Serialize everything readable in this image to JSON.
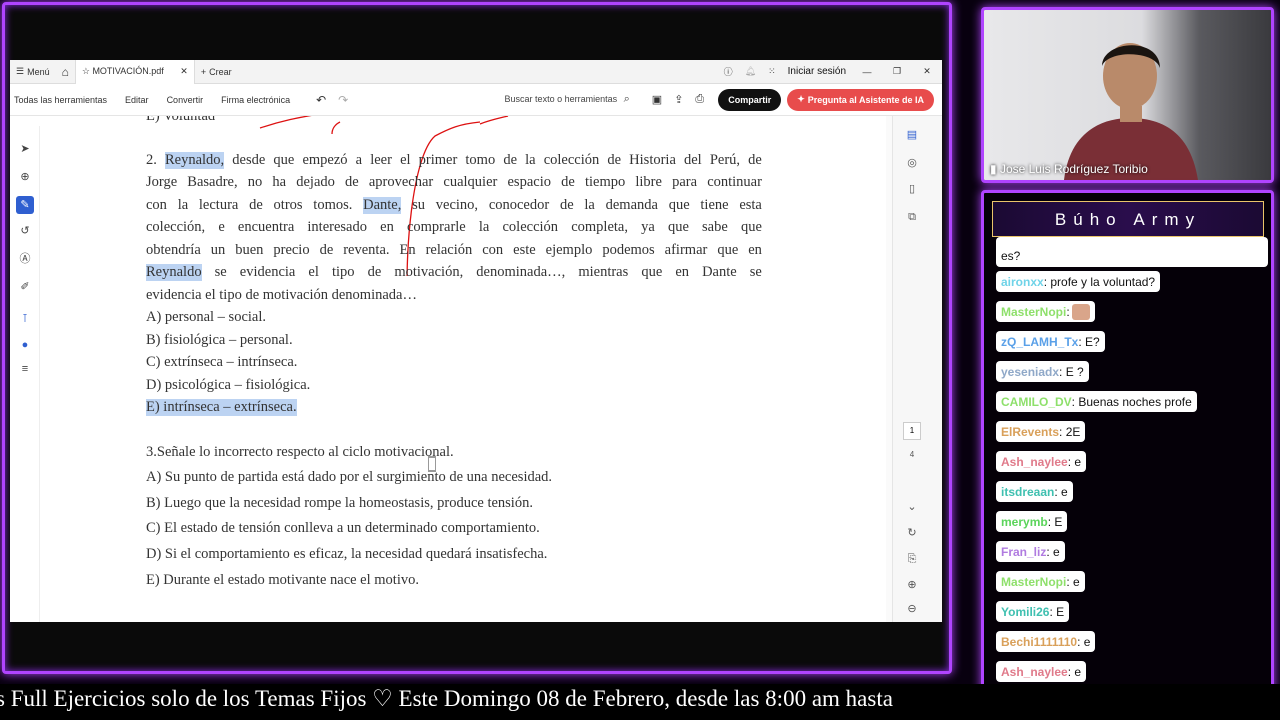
{
  "viewer": {
    "menu_label": "Menú",
    "tab_title": "MOTIVACIÓN.pdf",
    "new_tab_label": "Crear",
    "sign_in": "Iniciar sesión",
    "tools": [
      "Todas las herramientas",
      "Editar",
      "Convertir",
      "Firma electrónica"
    ],
    "search_placeholder": "Buscar texto o herramientas",
    "share_label": "Compartir",
    "ai_label": "Pregunta al Asistente de IA",
    "page_current": "1",
    "page_total": "4"
  },
  "document": {
    "prev_line": "E) Voluntad",
    "q2": {
      "line1": [
        "2.",
        "Reynaldo,",
        "desde",
        "que",
        "empezó",
        "a",
        "leer",
        "el",
        "primer",
        "tomo",
        "de",
        "la",
        "colección",
        "de",
        "Historia",
        "del",
        "Perú,",
        "de"
      ],
      "line2": [
        "Jorge",
        "Basadre,",
        "no",
        "ha",
        "dejado",
        "de",
        "aprovechar",
        "cualquier",
        "espacio",
        "de",
        "tiempo",
        "libre",
        "para",
        "continuar"
      ],
      "line3": [
        "con",
        "la",
        "lectura",
        "de",
        "otros",
        "tomos.",
        "Dante,",
        "su",
        "vecino,",
        "conocedor",
        "de",
        "la",
        "demanda",
        "que",
        "tiene",
        "esta"
      ],
      "line4": [
        "colección,",
        "e",
        "encuentra",
        "interesado",
        "en",
        "comprarle",
        "la",
        "colección",
        "completa,",
        "ya",
        "que",
        "sabe",
        "que"
      ],
      "line5": [
        "obtendría",
        "un",
        "buen",
        "precio",
        "de",
        "reventa.",
        "En",
        "relación",
        "con",
        "este",
        "ejemplo",
        "podemos",
        "afirmar",
        "que",
        "en"
      ],
      "line6": [
        "Reynaldo",
        "se",
        "evidencia",
        "el",
        "tipo",
        "de",
        "motivación,",
        "denominada…,",
        "mientras",
        "que",
        "en",
        "Dante",
        "se"
      ],
      "line7": "evidencia el tipo de motivación denominada…",
      "options": [
        "A) personal – social.",
        "B) fisiológica – personal.",
        "C) extrínseca – intrínseca.",
        "D) psicológica – fisiológica.",
        "E) intrínseca – extrínseca."
      ]
    },
    "q3": {
      "stem": "3.Señale lo incorrecto respecto al ciclo motivacional.",
      "options": [
        "A) Su punto de partida está dado por el surgimiento de una necesidad.",
        "B) Luego que la necesidad rompe la homeostasis, produce tensión.",
        "C) El estado de tensión conlleva a un determinado comportamiento.",
        "D) Si el comportamiento es eficaz, la necesidad quedará insatisfecha.",
        "E) Durante el estado motivante nace el motivo."
      ]
    }
  },
  "webcam": {
    "name": "Jose Luis Rodríguez Toribio"
  },
  "chat": {
    "title": "Búho Army",
    "messages": [
      {
        "user": "",
        "text": "es?",
        "color": "#ffffff"
      },
      {
        "user": "aironxx",
        "text": " : profe y la voluntad?",
        "color": "#6fd3e8"
      },
      {
        "user": "MasterNopi",
        "text": " : ",
        "color": "#8ee06b"
      },
      {
        "user": "zQ_LAMH_Tx",
        "text": " : E?",
        "color": "#5aa0e8"
      },
      {
        "user": "yeseniadx",
        "text": " : E ?",
        "color": "#8fa8c8"
      },
      {
        "user": "CAMILO_DV",
        "text": " : Buenas noches profe",
        "color": "#8ee06b"
      },
      {
        "user": "ElRevents",
        "text": " : 2E",
        "color": "#d9a05a"
      },
      {
        "user": "Ash_naylee",
        "text": " : e",
        "color": "#e07a8a"
      },
      {
        "user": "itsdreaan",
        "text": " : e",
        "color": "#3fc0b0"
      },
      {
        "user": "merymb",
        "text": " : E",
        "color": "#5bd45b"
      },
      {
        "user": "Fran_liz",
        "text": " : e",
        "color": "#b07be0"
      },
      {
        "user": "MasterNopi",
        "text": " : e",
        "color": "#8ee06b"
      },
      {
        "user": "Yomili26",
        "text": " : E",
        "color": "#3fc0b0"
      },
      {
        "user": "Bechi1111110",
        "text": " : e",
        "color": "#d9a05a"
      },
      {
        "user": "Ash_naylee",
        "text": " : e",
        "color": "#e07a8a"
      }
    ]
  },
  "ticker": {
    "text": "s Full Ejercicios solo de los Temas Fijos ♡  Este Domingo 08 de Febrero, desde las 8:00 am hasta"
  },
  "colors": {
    "frame": "#b044ff",
    "highlight": "#bcd3f2",
    "ai_button": "#e84c4c"
  }
}
